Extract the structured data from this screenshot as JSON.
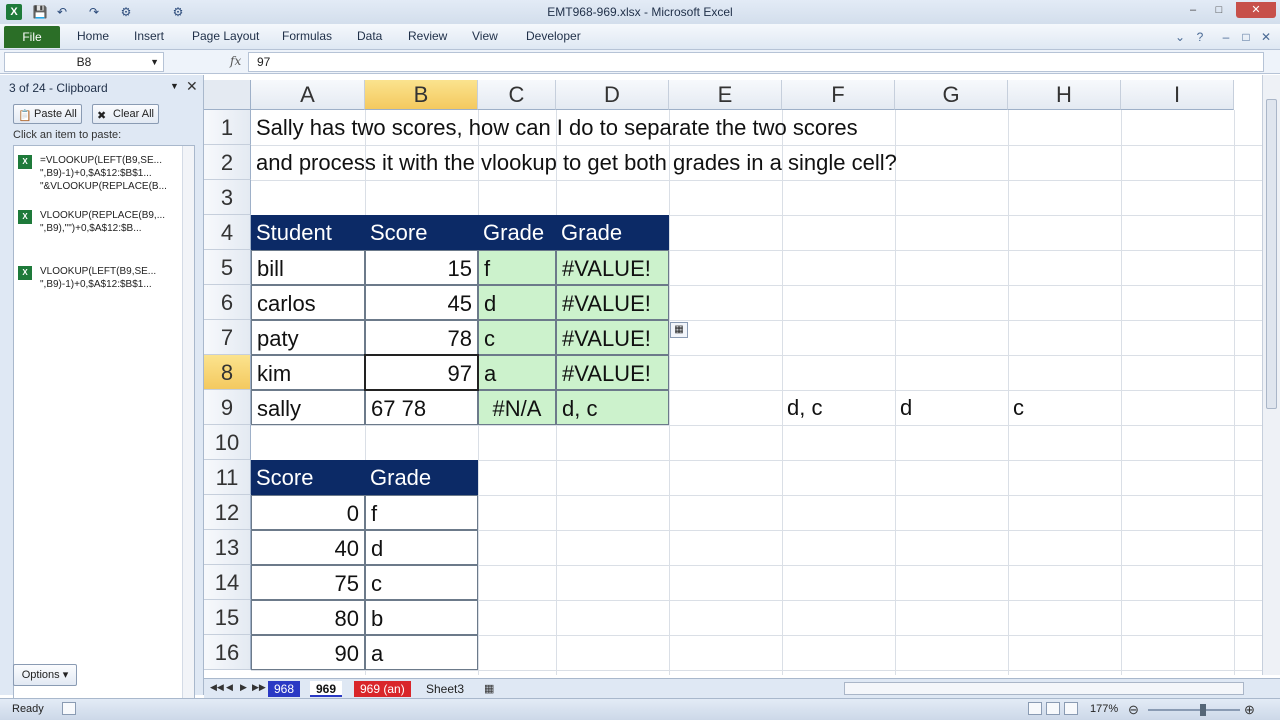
{
  "window": {
    "title": "EMT968-969.xlsx - Microsoft Excel",
    "app_logo": "X"
  },
  "ribbon": {
    "tabs": [
      "File",
      "Home",
      "Insert",
      "Page Layout",
      "Formulas",
      "Data",
      "Review",
      "View",
      "Developer"
    ]
  },
  "formula_bar": {
    "name_box": "B8",
    "fx": "fx",
    "formula": "97"
  },
  "clipboard": {
    "title": "3 of 24 - Clipboard",
    "paste_all": "Paste All",
    "clear_all": "Clear All",
    "hint": "Click an item to paste:",
    "items": [
      [
        "=VLOOKUP(LEFT(B9,SE...",
        "\",B9)-1)+0,$A$12:$B$1...",
        "\"&VLOOKUP(REPLACE(B..."
      ],
      [
        "VLOOKUP(REPLACE(B9,...",
        "\",B9),\"\")+0,$A$12:$B..."
      ],
      [
        "VLOOKUP(LEFT(B9,SE...",
        "\",B9)-1)+0,$A$12:$B$1..."
      ]
    ],
    "options": "Options"
  },
  "sheet": {
    "columns": [
      "A",
      "B",
      "C",
      "D",
      "E",
      "F",
      "G",
      "H",
      "I"
    ],
    "rows": [
      "1",
      "2",
      "3",
      "4",
      "5",
      "6",
      "7",
      "8",
      "9",
      "10",
      "11",
      "12",
      "13",
      "14",
      "15",
      "16"
    ],
    "selected_column": "B",
    "selected_row": "8",
    "note_line1": "Sally has two scores, how can I do to separate the two scores",
    "note_line2": "and process it with the vlookup to get both grades in a single cell?",
    "table1_headers": [
      "Student",
      "Score",
      "Grade",
      "Grade"
    ],
    "table1_rows": [
      [
        "bill",
        "15",
        "f",
        "#VALUE!"
      ],
      [
        "carlos",
        "45",
        "d",
        "#VALUE!"
      ],
      [
        "paty",
        "78",
        "c",
        "#VALUE!"
      ],
      [
        "kim",
        "97",
        "a",
        "#VALUE!"
      ],
      [
        "sally",
        "67 78",
        "#N/A",
        "d, c"
      ]
    ],
    "row9_extra": [
      "d, c",
      "d",
      "c"
    ],
    "table2_headers": [
      "Score",
      "Grade"
    ],
    "table2_rows": [
      [
        "0",
        "f"
      ],
      [
        "40",
        "d"
      ],
      [
        "75",
        "c"
      ],
      [
        "80",
        "b"
      ],
      [
        "90",
        "a"
      ]
    ]
  },
  "sheet_tabs": [
    "968",
    "969",
    "969 (an)",
    "Sheet3"
  ],
  "status": {
    "ready": "Ready",
    "zoom": "177%"
  }
}
